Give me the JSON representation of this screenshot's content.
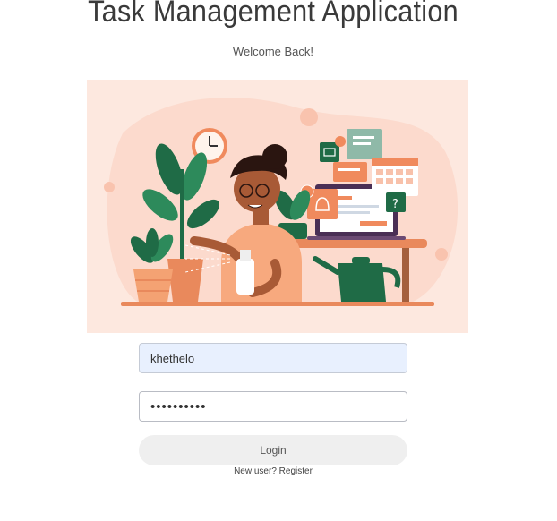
{
  "header": {
    "title": "Task Management Application",
    "subtitle": "Welcome Back!"
  },
  "illustration": {
    "icon": "woman-watering-plants-illustration",
    "background_color": "#fde8df"
  },
  "login_form": {
    "username_value": "khethelo",
    "password_mask": "••••••••••",
    "login_label": "Login",
    "new_user_text": "New user?",
    "register_label": "Register"
  },
  "colors": {
    "username_fill": "#e8f0fe",
    "button_fill": "#efefef",
    "accent_orange": "#f08a5d",
    "accent_green": "#1f6b46"
  }
}
